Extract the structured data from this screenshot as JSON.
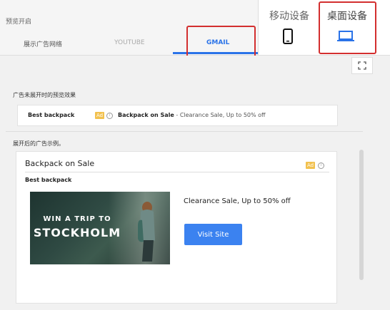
{
  "header": {
    "title": "预览开启",
    "tabs": [
      {
        "label": "展示广告网络"
      },
      {
        "label": "YOUTUBE"
      },
      {
        "label": "GMAIL"
      }
    ]
  },
  "devices": {
    "mobile": {
      "label": "移动设备",
      "icon": "phone-icon"
    },
    "desktop": {
      "label": "桌面设备",
      "icon": "laptop-icon"
    }
  },
  "collapsed": {
    "label": "广告未展开时的预览效果",
    "sender": "Best backpack",
    "ad_badge": "Ad",
    "info": "i",
    "subject": "Backpack on Sale",
    "snippet": " - Clearance Sale, Up to 50% off"
  },
  "expanded": {
    "label": "展开后的广告示例。",
    "title": "Backpack on Sale",
    "ad_badge": "Ad",
    "info": "i",
    "sender": "Best backpack",
    "image_line1": "WIN A TRIP TO",
    "image_line2": "STOCKHOLM",
    "headline": "Clearance Sale, Up to 50% off",
    "cta": "Visit Site"
  },
  "colors": {
    "accent": "#2a73e8",
    "highlight": "#d32f2f",
    "ad_badge": "#f2c14e",
    "cta": "#3b82f0"
  }
}
